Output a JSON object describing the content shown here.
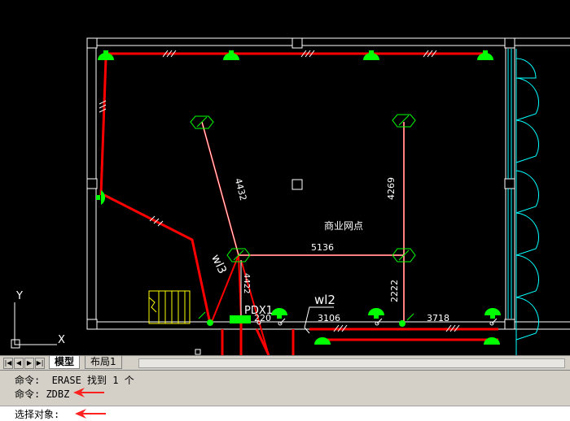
{
  "drawing": {
    "room_label": "商业网点",
    "dims": {
      "d_4432": "4432",
      "d_4269": "4269",
      "d_5136": "5136",
      "d_2222": "2222",
      "d_220": "220",
      "d_3106": "3106",
      "d_3718": "3718",
      "d_4422": "4422"
    },
    "wire_labels": {
      "wl3": "wl3",
      "wl2": "wl2"
    },
    "panel_label": "PDX1",
    "ucs": {
      "y": "Y",
      "x": "X"
    },
    "colors": {
      "wire": "#ff0000",
      "wall": "#ffffff",
      "fixture": "#00ff00",
      "window": "#00ffff",
      "stair": "#ffff00"
    }
  },
  "tabs": {
    "nav": [
      "|◀",
      "◀",
      "▶",
      "▶|"
    ],
    "model": "模型",
    "layout1": "布局1"
  },
  "command": {
    "line1": "命令:  ERASE 找到 1 个",
    "line2": "命令: ZDBZ",
    "prompt": "选择对象:"
  }
}
